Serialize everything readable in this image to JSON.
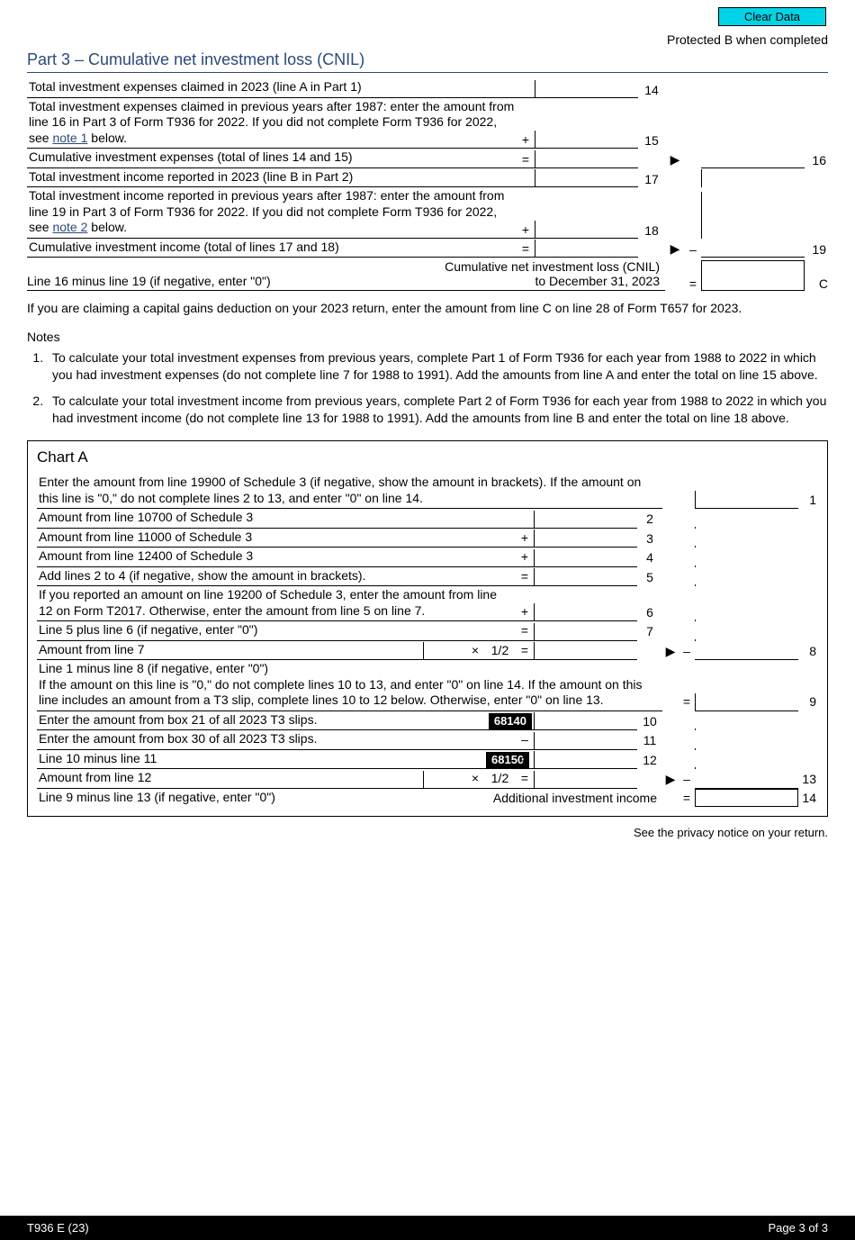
{
  "header": {
    "clear_button": "Clear Data",
    "protected": "Protected B when completed"
  },
  "part3": {
    "title": "Part 3 – Cumulative net investment loss (CNIL)",
    "rows": {
      "r14": {
        "text": "Total investment expenses claimed in 2023 (line A in Part 1)",
        "num": "14"
      },
      "r15": {
        "text": "Total investment expenses claimed in previous years after 1987: enter the amount from line 16 in Part 3 of Form T936 for 2022. If you did not complete Form T936 for 2022, see ",
        "link": "note 1",
        "tail": " below.",
        "op": "+",
        "num": "15"
      },
      "r16": {
        "text": "Cumulative investment expenses (total of lines 14 and 15)",
        "op": "=",
        "arrow": "▶",
        "num": "16"
      },
      "r17": {
        "text": "Total investment income reported in 2023 (line B in Part 2)",
        "num": "17"
      },
      "r18": {
        "text": "Total investment income reported in previous years after 1987: enter the amount from line 19 in Part 3 of Form T936 for 2022. If you did not complete Form T936 for 2022, see ",
        "link": "note 2",
        "tail": " below.",
        "op": "+",
        "num": "18"
      },
      "r19": {
        "text": "Cumulative investment income (total of lines 17 and 18)",
        "op": "=",
        "arrow": "▶",
        "dash": "–",
        "num": "19"
      }
    },
    "cnil": {
      "label1": "Cumulative net investment loss (CNIL)",
      "label2": "to December 31, 2023",
      "left": "Line 16 minus line 19 (if negative, enter \"0\")",
      "eq": "=",
      "letter": "C"
    },
    "instruction": "If you are claiming a capital gains deduction on your 2023 return, enter the amount from line C on line 28 of Form T657 for 2023.",
    "notes_heading": "Notes",
    "note1": "To calculate your total investment expenses from previous years, complete Part 1 of Form T936 for each year from 1988 to 2022 in which you had investment expenses (do not complete line 7 for 1988 to 1991). Add the amounts from line A and enter the total on line 15 above.",
    "note2": "To calculate your total investment income from previous years, complete Part 2 of Form T936 for each year from 1988 to 2022 in which you had investment income (do not complete line 13 for 1988 to 1991). Add the amounts from line B and enter the total on line 18 above."
  },
  "chartA": {
    "title": "Chart A",
    "r1": {
      "text": "Enter the amount from line 19900 of Schedule 3 (if negative, show the amount in brackets). If the amount on this line is \"0,\" do not complete lines 2 to 13, and enter \"0\" on line 14.",
      "num": "1"
    },
    "r2": {
      "text": "Amount from line 10700 of Schedule 3",
      "num": "2"
    },
    "r3": {
      "text": "Amount from line 11000 of Schedule 3",
      "op": "+",
      "num": "3"
    },
    "r4": {
      "text": "Amount from line 12400 of Schedule 3",
      "op": "+",
      "num": "4"
    },
    "r5": {
      "text": "Add lines 2 to 4 (if negative, show the amount in brackets).",
      "op": "=",
      "num": "5"
    },
    "r6": {
      "text": "If you reported an amount on line 19200 of Schedule 3, enter the amount from line 12 on Form T2017. Otherwise, enter the amount from line 5 on line 7.",
      "op": "+",
      "num": "6"
    },
    "r7": {
      "text": "Line 5 plus line 6 (if negative, enter \"0\")",
      "op": "=",
      "num": "7"
    },
    "r8": {
      "text": "Amount from line 7",
      "mult": "×",
      "half": "1/2",
      "eq": "=",
      "arrow": "▶",
      "dash": "–",
      "num": "8"
    },
    "r9": {
      "text": "Line 1 minus line 8 (if negative, enter \"0\")\nIf the amount on this line is \"0,\" do not complete lines 10 to 13, and enter \"0\" on line 14. If the amount on this line includes an amount from a T3 slip, complete lines 10 to 12 below. Otherwise, enter \"0\" on line 13.",
      "eq": "=",
      "num": "9"
    },
    "r10": {
      "text": "Enter the amount from box 21 of all 2023 T3 slips.",
      "tag": "68140",
      "num": "10"
    },
    "r11": {
      "text": "Enter the amount from box 30 of all 2023 T3 slips.",
      "op": "–",
      "num": "11"
    },
    "r12": {
      "text": "Line 10 minus line 11",
      "tag": "68150",
      "op": "=",
      "num": "12"
    },
    "r13": {
      "text": "Amount from line 12",
      "mult": "×",
      "half": "1/2",
      "eq": "=",
      "arrow": "▶",
      "dash": "–",
      "num": "13"
    },
    "r14": {
      "text": "Line 9 minus line 13 (if negative, enter \"0\")",
      "label": "Additional investment income",
      "eq": "=",
      "num": "14"
    }
  },
  "privacy": "See the privacy notice on your return.",
  "footer": {
    "form": "T936 E (23)",
    "page": "Page 3 of 3"
  }
}
